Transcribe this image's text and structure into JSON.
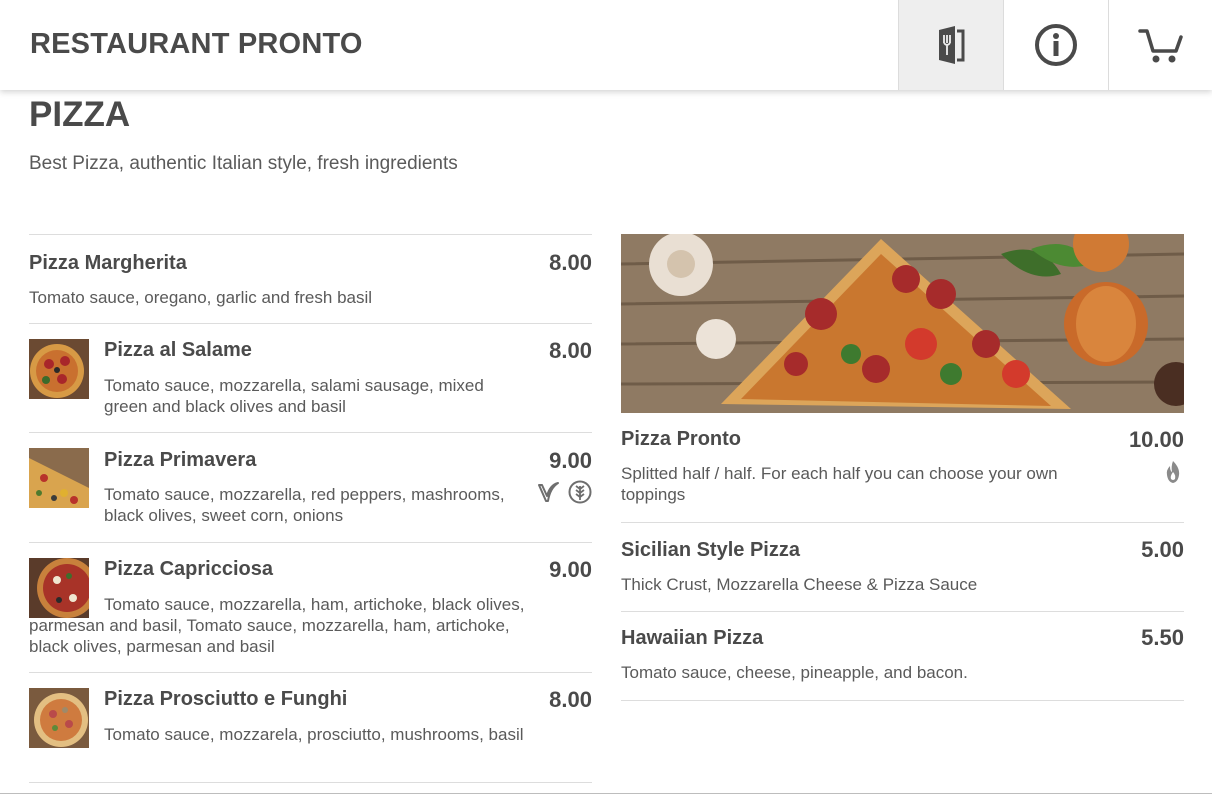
{
  "header": {
    "brand": "RESTAURANT PRONTO",
    "nav": [
      {
        "icon": "menu-book-icon",
        "active": true
      },
      {
        "icon": "info-icon",
        "active": false
      },
      {
        "icon": "cart-icon",
        "active": false
      }
    ]
  },
  "category": {
    "title": "PIZZA",
    "description": "Best Pizza, authentic Italian style, fresh ingredients"
  },
  "left_items": [
    {
      "name": "Pizza Margherita",
      "price": "8.00",
      "description": "Tomato sauce, oregano, garlic and fresh basil"
    },
    {
      "name": "Pizza al Salame",
      "price": "8.00",
      "description": "Tomato sauce, mozzarella, salami sausage, mixed green and black olives and basil"
    },
    {
      "name": "Pizza Primavera",
      "price": "9.00",
      "description": "Tomato sauce, mozzarella, red peppers, mashrooms, black olives, sweet corn, onions",
      "badges": [
        "vegan-icon",
        "gluten-free-icon"
      ]
    },
    {
      "name": "Pizza Capricciosa",
      "price": "9.00",
      "description": "Tomato sauce, mozzarella, ham, artichoke, black olives, parmesan and basil, Tomato sauce, mozzarella, ham, artichoke, black olives, parmesan and basil"
    },
    {
      "name": "Pizza Prosciutto e Funghi",
      "price": "8.00",
      "description": "Tomato sauce, mozzarela, prosciutto, mushrooms, basil"
    }
  ],
  "right_items": [
    {
      "name": "Pizza Pronto",
      "price": "10.00",
      "description": "Splitted half / half. For each half you can choose your own toppings",
      "badges": [
        "spicy-icon"
      ]
    },
    {
      "name": "Sicilian Style Pizza",
      "price": "5.00",
      "description": "Thick Crust, Mozzarella Cheese & Pizza Sauce"
    },
    {
      "name": "Hawaiian Pizza",
      "price": "5.50",
      "description": "Tomato sauce, cheese, pineapple, and bacon."
    }
  ],
  "colors": {
    "text": "#4a4a4a",
    "muted": "#5a5a5a",
    "divider": "#dddddd",
    "active_nav": "#eeeeee"
  }
}
